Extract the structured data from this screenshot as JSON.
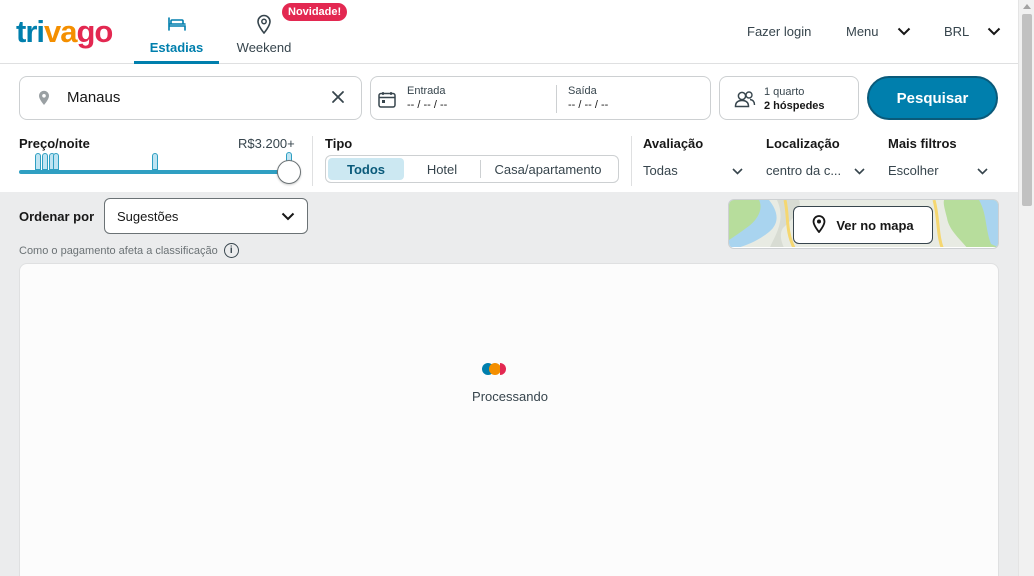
{
  "brand": {
    "logo_parts": [
      "tri",
      "va",
      "go"
    ],
    "logo_colors": [
      "#007fad",
      "#f48f00",
      "#e32851"
    ]
  },
  "nav": {
    "tabs": [
      {
        "label": "Estadias",
        "icon": "bed-icon",
        "active": true
      },
      {
        "label": "Weekend",
        "icon": "location-pin-icon",
        "active": false
      }
    ],
    "new_badge": "Novidade!"
  },
  "header": {
    "login": "Fazer login",
    "menu": "Menu",
    "currency": "BRL"
  },
  "search": {
    "destination": "Manaus",
    "checkin_label": "Entrada",
    "checkin_value": "-- / -- / --",
    "checkout_label": "Saída",
    "checkout_value": "-- / -- / --",
    "rooms": "1 quarto",
    "guests": "2 hóspedes",
    "button": "Pesquisar"
  },
  "filters": {
    "price_label": "Preço/noite",
    "price_max": "R$3.200+",
    "price_level": 1.0,
    "type_label": "Tipo",
    "type_options": [
      "Todos",
      "Hotel",
      "Casa/apartamento"
    ],
    "type_selected": "Todos",
    "rating_label": "Avaliação",
    "rating_value": "Todas",
    "location_label": "Localização",
    "location_value": "centro da c...",
    "more_label": "Mais filtros",
    "more_value": "Escolher"
  },
  "sort": {
    "label": "Ordenar por",
    "value": "Sugestões",
    "payment_note": "Como o pagamento afeta a classificação"
  },
  "map": {
    "button": "Ver no mapa"
  },
  "results": {
    "status": "Processando"
  },
  "colors": {
    "primary": "#007fad",
    "accent_red": "#e32851",
    "accent_orange": "#f48f00"
  }
}
